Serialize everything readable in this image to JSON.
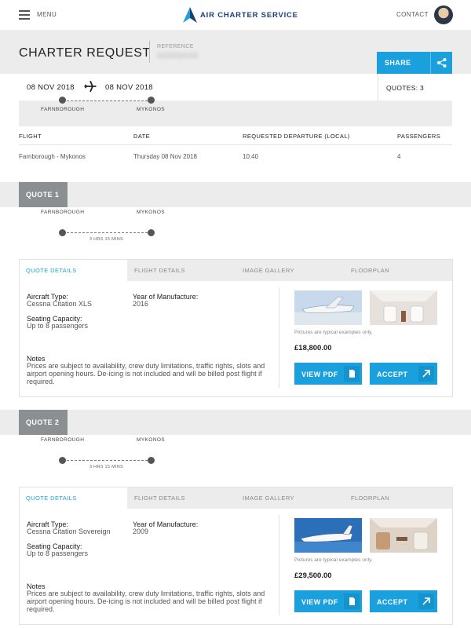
{
  "header": {
    "menu_label": "MENU",
    "logo_text": "AIR CHARTER SERVICE",
    "contact_label": "CONTACT",
    "icons": [
      "hamburger-icon",
      "ac-logo-icon",
      "avatar"
    ]
  },
  "request": {
    "title": "CHARTER REQUEST",
    "reference_label": "REFERENCE",
    "reference_value": "42003444",
    "share_label": "SHARE",
    "depart_date": "08 NOV 2018",
    "return_date": "08 NOV 2018",
    "quotes_count": "QUOTES: 3",
    "origin": "FARNBOROUGH",
    "destination": "MYKONOS"
  },
  "flight_table": {
    "headers": [
      "FLIGHT",
      "DATE",
      "REQUESTED DEPARTURE (LOCAL)",
      "PASSENGERS"
    ],
    "rows": [
      [
        "Farnborough - Mykonos",
        "Thursday 08 Nov 2018",
        "10:40",
        "4"
      ]
    ]
  },
  "quotes": [
    {
      "label": "QUOTE 1",
      "origin": "FARNBOROUGH",
      "destination": "MYKONOS",
      "duration": "3 HRS 15 MINS",
      "tabs": [
        "QUOTE DETAILS",
        "FLIGHT DETAILS",
        "IMAGE GALLERY",
        "FLOORPLAN"
      ],
      "aircraft_type_label": "Aircraft Type:",
      "aircraft_type": "Cessna Citation XLS",
      "year_label": "Year of Manufacture:",
      "year": "2016",
      "seating_label": "Seating Capacity:",
      "seating": "Up to 8 passengers",
      "notes_label": "Notes",
      "notes": "Prices are subject to availability, crew duty limitations, traffic rights, slots and airport opening hours. De-icing is not included and will be billed post flight if required.",
      "disclaimer": "Pictures are typical examples only.",
      "price": "£18,800.00",
      "view_pdf_label": "VIEW PDF",
      "accept_label": "ACCEPT"
    },
    {
      "label": "QUOTE 2",
      "origin": "FARNBOROUGH",
      "destination": "MYKONOS",
      "duration": "3 HRS 15 MINS",
      "tabs": [
        "QUOTE DETAILS",
        "FLIGHT DETAILS",
        "IMAGE GALLERY",
        "FLOORPLAN"
      ],
      "aircraft_type_label": "Aircraft Type:",
      "aircraft_type": "Cessna Citation Sovereign",
      "year_label": "Year of Manufacture:",
      "year": "2009",
      "seating_label": "Seating Capacity:",
      "seating": "Up to 8 passengers",
      "notes_label": "Notes",
      "notes": "Prices are subject to availability, crew duty limitations, traffic rights, slots and airport opening hours. De-icing is not included and will be billed post flight if required.",
      "disclaimer": "Pictures are typical examples only.",
      "price": "£29,500.00",
      "view_pdf_label": "VIEW PDF",
      "accept_label": "ACCEPT"
    }
  ],
  "colors": {
    "accent": "#1aa0dc",
    "brand_navy": "#1c3f73",
    "tab_gray": "#8c8f92",
    "band_gray": "#ececec"
  }
}
